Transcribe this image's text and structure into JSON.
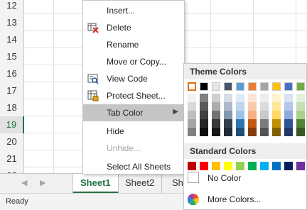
{
  "grid": {
    "rows": [
      "12",
      "13",
      "14",
      "15",
      "16",
      "17",
      "18",
      "19",
      "20",
      "21",
      "22",
      "23",
      "24"
    ],
    "selected_row": "19"
  },
  "tabs": {
    "items": [
      "Sheet1",
      "Sheet2",
      "Sh"
    ],
    "active": "Sheet1"
  },
  "status": {
    "text": "Ready"
  },
  "context_menu": {
    "items": [
      {
        "label": "Insert...",
        "icon": "insert-icon",
        "enabled": true
      },
      {
        "label": "Delete",
        "icon": "delete-icon",
        "enabled": true
      },
      {
        "label": "Rename",
        "icon": "",
        "enabled": true
      },
      {
        "label": "Move or Copy...",
        "icon": "",
        "enabled": true
      },
      {
        "label": "View Code",
        "icon": "view-code-icon",
        "enabled": true
      },
      {
        "label": "Protect Sheet...",
        "icon": "protect-sheet-icon",
        "enabled": true
      },
      {
        "label": "Tab Color",
        "icon": "",
        "enabled": true,
        "highlighted": true,
        "submenu": "▶"
      },
      {
        "label": "Hide",
        "icon": "",
        "enabled": true
      },
      {
        "label": "Unhide...",
        "icon": "",
        "enabled": false
      },
      {
        "label": "Select All Sheets",
        "icon": "",
        "enabled": true
      }
    ]
  },
  "palette": {
    "theme_title": "Theme Colors",
    "standard_title": "Standard Colors",
    "no_color_label": "No Color",
    "more_colors_label": "More Colors...",
    "theme_columns": [
      [
        "#ffffff",
        "#f2f2f2",
        "#d9d9d9",
        "#bfbfbf",
        "#a6a6a6",
        "#808080"
      ],
      [
        "#000000",
        "#7f7f7f",
        "#595959",
        "#404040",
        "#262626",
        "#0d0d0d"
      ],
      [
        "#e7e6e6",
        "#d0cece",
        "#aeabab",
        "#757171",
        "#3a3838",
        "#171616"
      ],
      [
        "#44546a",
        "#d6dce4",
        "#adb9ca",
        "#8497b0",
        "#333f4f",
        "#222a35"
      ],
      [
        "#5b9bd5",
        "#ddebf7",
        "#bdd7ee",
        "#9bc2e6",
        "#2f75b5",
        "#1f4e78"
      ],
      [
        "#ed7d31",
        "#fce4d6",
        "#f8cbad",
        "#f4b084",
        "#c65911",
        "#833c0c"
      ],
      [
        "#a5a5a5",
        "#ededed",
        "#dbdbdb",
        "#c9c9c9",
        "#7b7b7b",
        "#525252"
      ],
      [
        "#ffc000",
        "#fff2cc",
        "#ffe699",
        "#ffd966",
        "#bf8f00",
        "#806000"
      ],
      [
        "#4472c4",
        "#d9e1f2",
        "#b4c6e7",
        "#8ea9db",
        "#305496",
        "#203764"
      ],
      [
        "#70ad47",
        "#e2efda",
        "#c6e0b4",
        "#a9d08e",
        "#548235",
        "#375623"
      ]
    ],
    "standard_colors": [
      "#c00000",
      "#ff0000",
      "#ffc000",
      "#ffff00",
      "#92d050",
      "#00b050",
      "#00b0f0",
      "#0070c0",
      "#002060",
      "#7030a0"
    ]
  }
}
